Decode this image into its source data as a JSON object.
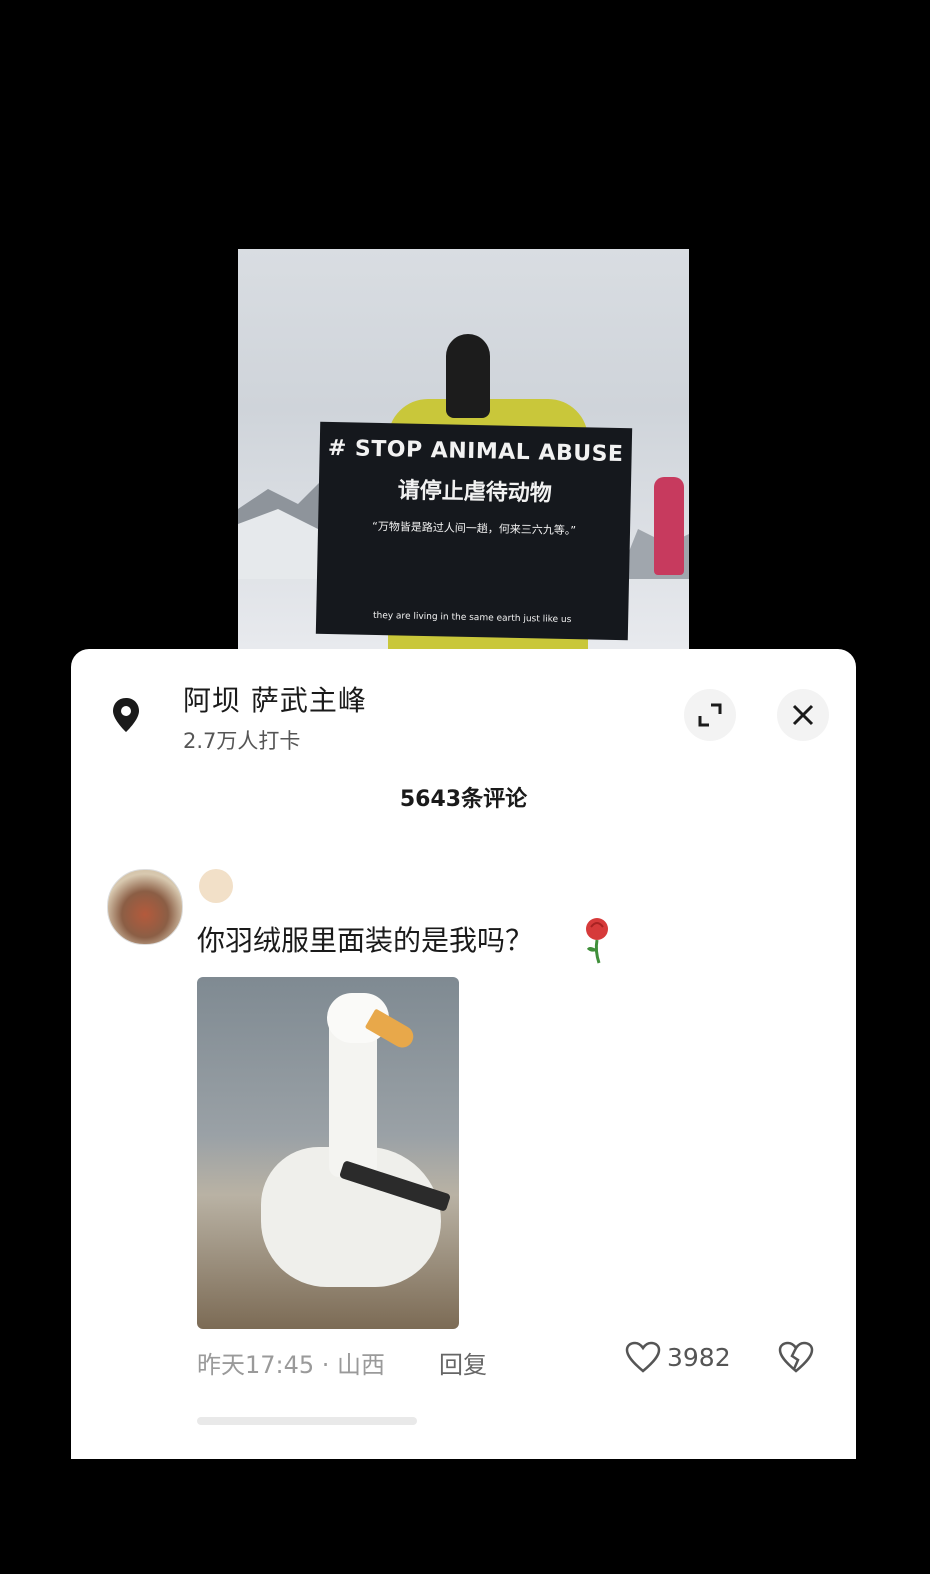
{
  "video": {
    "banner_line1": "# STOP ANIMAL ABUSE",
    "banner_line2": "请停止虐待动物",
    "banner_line3": "“万物皆是路过人间一趟，何来三六九等。”",
    "banner_line4": "they are living in the same earth just like us"
  },
  "location": {
    "title": "阿坝  萨武主峰",
    "subtitle": "2.7万人打卡",
    "icon": "map-pin-icon"
  },
  "controls": {
    "expand_icon": "expand-icon",
    "close_icon": "close-icon"
  },
  "comments": {
    "count_label": "5643条评论",
    "items": [
      {
        "text": "你羽绒服里面装的是我吗？",
        "emoji": "rose",
        "image": "duck-holding-gun",
        "time": "昨天17:45 · 山西",
        "reply_label": "回复",
        "likes": "3982"
      }
    ]
  }
}
